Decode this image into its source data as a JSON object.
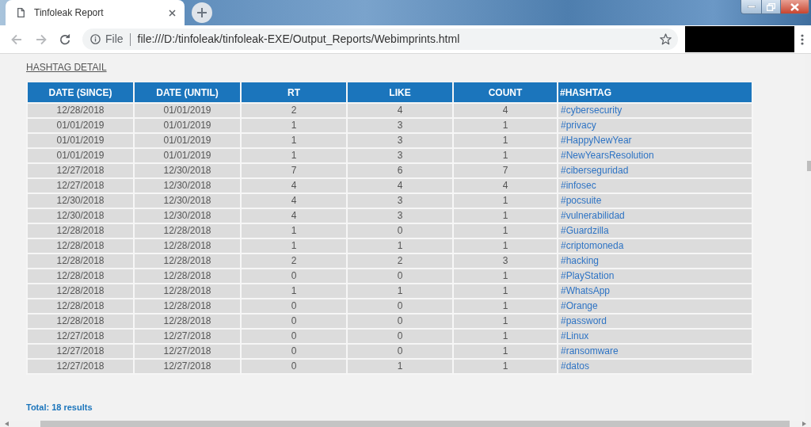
{
  "browser": {
    "tabs": [
      {
        "title": "Tinfoleak Report",
        "selected": true
      }
    ]
  },
  "address_bar": {
    "security_label": "File",
    "url": "file:///D:/tinfoleak/tinfoleak-EXE/Output_Reports/Webimprints.html"
  },
  "page": {
    "section_title": "HASHTAG DETAIL",
    "table": {
      "columns": [
        {
          "label": "DATE (SINCE)",
          "kind": "text"
        },
        {
          "label": "DATE (UNTIL)",
          "kind": "text"
        },
        {
          "label": "RT",
          "kind": "text"
        },
        {
          "label": "LIKE",
          "kind": "text"
        },
        {
          "label": "COUNT",
          "kind": "text"
        },
        {
          "label": "#HASHTAG",
          "kind": "link"
        }
      ],
      "rows": [
        [
          "12/28/2018",
          "01/01/2019",
          "2",
          "4",
          "4",
          "#cybersecurity"
        ],
        [
          "01/01/2019",
          "01/01/2019",
          "1",
          "3",
          "1",
          "#privacy"
        ],
        [
          "01/01/2019",
          "01/01/2019",
          "1",
          "3",
          "1",
          "#HappyNewYear"
        ],
        [
          "01/01/2019",
          "01/01/2019",
          "1",
          "3",
          "1",
          "#NewYearsResolution"
        ],
        [
          "12/27/2018",
          "12/30/2018",
          "7",
          "6",
          "7",
          "#ciberseguridad"
        ],
        [
          "12/27/2018",
          "12/30/2018",
          "4",
          "4",
          "4",
          "#infosec"
        ],
        [
          "12/30/2018",
          "12/30/2018",
          "4",
          "3",
          "1",
          "#pocsuite"
        ],
        [
          "12/30/2018",
          "12/30/2018",
          "4",
          "3",
          "1",
          "#vulnerabilidad"
        ],
        [
          "12/28/2018",
          "12/28/2018",
          "1",
          "0",
          "1",
          "#Guardzilla"
        ],
        [
          "12/28/2018",
          "12/28/2018",
          "1",
          "1",
          "1",
          "#criptomoneda"
        ],
        [
          "12/28/2018",
          "12/28/2018",
          "2",
          "2",
          "3",
          "#hacking"
        ],
        [
          "12/28/2018",
          "12/28/2018",
          "0",
          "0",
          "1",
          "#PlayStation"
        ],
        [
          "12/28/2018",
          "12/28/2018",
          "1",
          "1",
          "1",
          "#WhatsApp"
        ],
        [
          "12/28/2018",
          "12/28/2018",
          "0",
          "0",
          "1",
          "#Orange"
        ],
        [
          "12/28/2018",
          "12/28/2018",
          "0",
          "0",
          "1",
          "#password"
        ],
        [
          "12/27/2018",
          "12/27/2018",
          "0",
          "0",
          "1",
          "#Linux"
        ],
        [
          "12/27/2018",
          "12/27/2018",
          "0",
          "0",
          "1",
          "#ransomware"
        ],
        [
          "12/27/2018",
          "12/27/2018",
          "0",
          "1",
          "1",
          "#datos"
        ]
      ]
    },
    "total": "Total: 18 results"
  }
}
